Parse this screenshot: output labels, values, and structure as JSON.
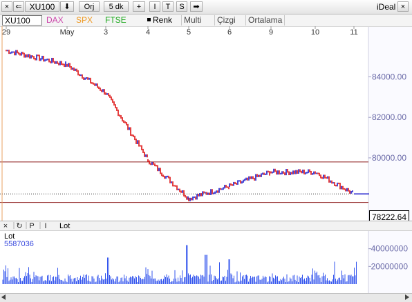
{
  "toolbar": {
    "close": "×",
    "back": "⇐",
    "symbol": "XU100",
    "down": "⬇",
    "orj": "Orj",
    "period": "5 dk",
    "plus": "+",
    "i": "I",
    "t": "T",
    "s": "S",
    "arrow": "➡",
    "brand": "iDeal"
  },
  "symbols": {
    "xu100": "XU100",
    "dax": "DAX",
    "spx": "SPX",
    "ftse": "FTSE",
    "renk": "Renk",
    "multi": "Multi",
    "cizgi": "Çizgi",
    "ortalama": "Ortalama"
  },
  "x_axis": {
    "labels": [
      "29",
      "May",
      "3",
      "4",
      "5",
      "6",
      "9",
      "10",
      "11"
    ]
  },
  "price_axis": {
    "labels": [
      "84000.00",
      "82000.00",
      "80000.00"
    ]
  },
  "current_price": "78222.64",
  "volume_panel": {
    "buttons": [
      "×",
      "↻",
      "P",
      "I"
    ],
    "title": "Lot",
    "legend_name": "Lot",
    "legend_value": "5587036",
    "labels": [
      "40000000",
      "20000000"
    ]
  },
  "colors": {
    "up": "#1a1acc",
    "down": "#dd1111",
    "volume": "#3355ee",
    "hline": "#8b1a1a",
    "axis_text": "#6a6aa8"
  },
  "chart_data": [
    {
      "type": "line",
      "series": [
        {
          "x": [
            "29",
            "May",
            "3",
            "4",
            "5",
            "6",
            "9",
            "10",
            "11"
          ],
          "y": [
            85300,
            84600,
            83200,
            79900,
            78000,
            78600,
            79300,
            79300,
            78220
          ]
        }
      ],
      "ylim": [
        76900,
        86500
      ],
      "hlines": [
        79800,
        77800
      ],
      "ytick_labels": [
        "84000.00",
        "82000.00",
        "80000.00"
      ]
    },
    {
      "type": "bar",
      "series": [
        {
          "name": "Lot",
          "last": 5587036
        }
      ],
      "ylim": [
        0,
        60000000
      ],
      "ytick_labels": [
        "40000000",
        "20000000"
      ]
    }
  ]
}
